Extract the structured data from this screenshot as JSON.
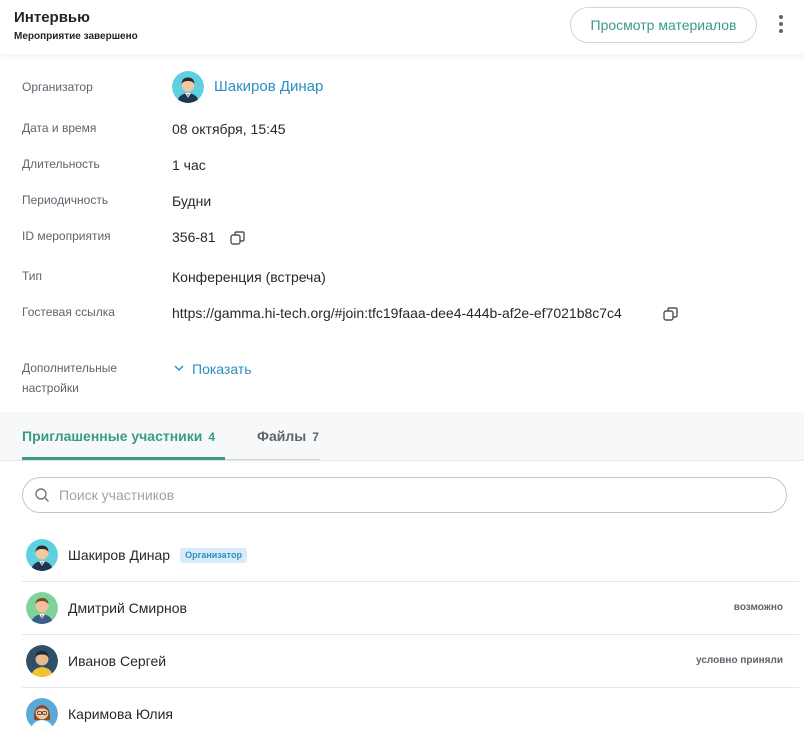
{
  "header": {
    "title": "Интервью",
    "subtitle": "Мероприятие завершено",
    "materials_button": "Просмотр материалов"
  },
  "details": {
    "organizer_label": "Организатор",
    "organizer_name": "Шакиров Динар",
    "datetime_label": "Дата и время",
    "datetime_value": "08 октября, 15:45",
    "duration_label": "Длительность",
    "duration_value": "1 час",
    "recurrence_label": "Периодичность",
    "recurrence_value": "Будни",
    "event_id_label": "ID мероприятия",
    "event_id_value": "356-81",
    "type_label": "Тип",
    "type_value": "Конференция (встреча)",
    "guest_link_label": "Гостевая ссылка",
    "guest_link_value": "https://gamma.hi-tech.org/#join:tfc19faaa-dee4-444b-af2e-ef7021b8c7c4",
    "extra_settings_label_line1": "Дополнительные",
    "extra_settings_label_line2": "настройки",
    "show_link": "Показать"
  },
  "tabs": [
    {
      "label": "Приглашенные участники",
      "count": "4"
    },
    {
      "label": "Файлы",
      "count": "7"
    }
  ],
  "search": {
    "placeholder": "Поиск участников",
    "value": ""
  },
  "participants": [
    {
      "name": "Шакиров Динар",
      "badge": "Организатор",
      "status": ""
    },
    {
      "name": "Дмитрий Смирнов",
      "badge": "",
      "status": "возможно"
    },
    {
      "name": "Иванов Сергей",
      "badge": "",
      "status": "условно приняли"
    },
    {
      "name": "Каримова Юлия",
      "badge": "",
      "status": ""
    }
  ],
  "colors": {
    "accent_green": "#3a9a88",
    "link_blue": "#2a8fc4",
    "badge_bg": "#d6ecf8"
  },
  "icons": [
    "copy-icon",
    "search-icon",
    "chevron-down-icon",
    "more-vertical-icon"
  ]
}
